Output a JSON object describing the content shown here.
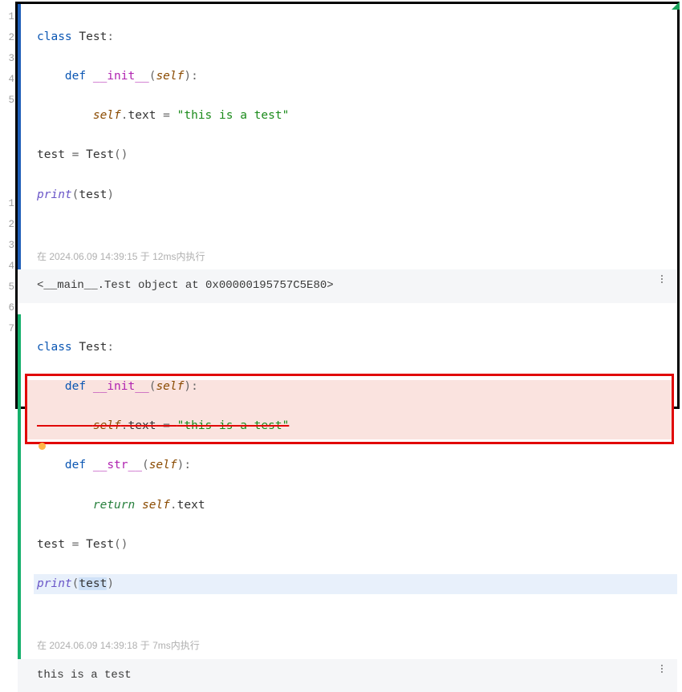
{
  "line_numbers_1": [
    "1",
    "2",
    "3",
    "4",
    "5"
  ],
  "line_numbers_2": [
    "1",
    "2",
    "3",
    "4",
    "5",
    "6",
    "7"
  ],
  "cell1": {
    "code": {
      "l1_class": "class",
      "l1_name": "Test",
      "l1_colon": ":",
      "l2_def": "def",
      "l2_fn": "__init__",
      "l2_lp": "(",
      "l2_self": "self",
      "l2_rp": "):",
      "l3_self": "self",
      "l3_dot": ".",
      "l3_attr": "text",
      "l3_eq": " = ",
      "l3_str": "\"this is a test\"",
      "l4_var": "test",
      "l4_eq": " = ",
      "l4_call": "Test",
      "l4_paren": "()",
      "l5_print": "print",
      "l5_lp": "(",
      "l5_arg": "test",
      "l5_rp": ")"
    },
    "meta": "在 2024.06.09 14:39:15 于 12ms内执行",
    "output": "<__main__.Test object at 0x00000195757C5E80>"
  },
  "cell2": {
    "code": {
      "l1_class": "class",
      "l1_name": "Test",
      "l1_colon": ":",
      "l2_def": "def",
      "l2_fn": "__init__",
      "l2_lp": "(",
      "l2_self": "self",
      "l2_rp": "):",
      "l3_self": "self",
      "l3_dot": ".",
      "l3_attr": "text",
      "l3_eq": " = ",
      "l3_str": "\"this is a test\"",
      "l4_def": "def",
      "l4_fn": "__str__",
      "l4_lp": "(",
      "l4_self": "self",
      "l4_rp": "):",
      "l5_return": "return",
      "l5_self": "self",
      "l5_dot": ".",
      "l5_attr": "text",
      "l6_var": "test",
      "l6_eq": " = ",
      "l6_call": "Test",
      "l6_paren": "()",
      "l7_print": "print",
      "l7_lp": "(",
      "l7_arg": "test",
      "l7_rp": ")"
    },
    "meta": "在 2024.06.09 14:39:18 于 7ms内执行",
    "output": "this is a test"
  },
  "icons": {
    "kebab": "more-vert-icon"
  }
}
